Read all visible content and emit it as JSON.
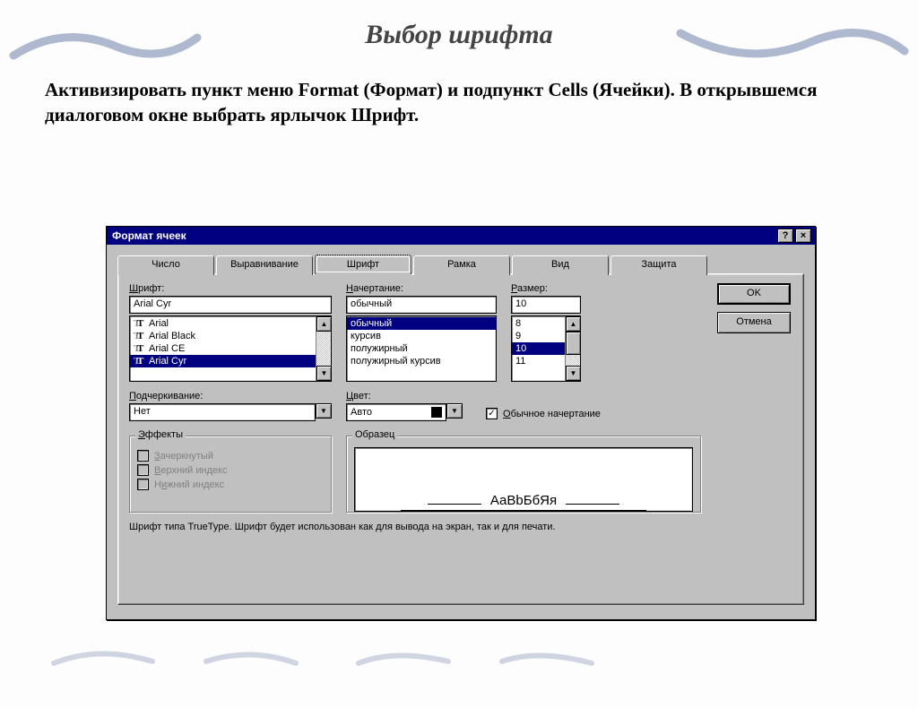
{
  "slide": {
    "title": "Выбор шрифта",
    "body": "Активизировать пункт меню Format (Формат) и подпункт Cells (Ячейки). В открывшемся диалоговом окне выбрать ярлычок Шрифт."
  },
  "dialog": {
    "title": "Формат ячеек",
    "help_btn": "?",
    "close_btn": "×",
    "tabs": [
      "Число",
      "Выравнивание",
      "Шрифт",
      "Рамка",
      "Вид",
      "Защита"
    ],
    "active_tab_index": 2,
    "ok": "OK",
    "cancel": "Отмена",
    "font": {
      "label": "Шрифт:",
      "label_accel": "Ш",
      "value": "Arial Cyr",
      "list": [
        "Arial",
        "Arial Black",
        "Arial CE",
        "Arial Cyr"
      ],
      "selected_index": 3
    },
    "style": {
      "label": "Начертание:",
      "label_accel": "Н",
      "value": "обычный",
      "list": [
        "обычный",
        "курсив",
        "полужирный",
        "полужирный курсив"
      ],
      "selected_index": 0
    },
    "size": {
      "label": "Размер:",
      "label_accel": "Р",
      "value": "10",
      "list": [
        "8",
        "9",
        "10",
        "11"
      ],
      "selected_index": 2
    },
    "underline": {
      "label": "Подчеркивание:",
      "label_accel": "П",
      "value": "Нет"
    },
    "color": {
      "label": "Цвет:",
      "label_accel": "Ц",
      "value": "Авто"
    },
    "normal_font": {
      "label": "Обычное начертание",
      "accel": "О",
      "checked": true
    },
    "effects": {
      "legend": "Эффекты",
      "legend_accel": "Э",
      "strike": "Зачеркнутый",
      "strike_accel": "З",
      "super": "Верхний индекс",
      "super_accel": "В",
      "sub": "Нижний индекс",
      "sub_accel": "и"
    },
    "preview": {
      "legend": "Образец",
      "sample": "АаВbБбЯя"
    },
    "hint": "Шрифт типа TrueType. Шрифт будет использован как для вывода на экран, так и для печати."
  }
}
